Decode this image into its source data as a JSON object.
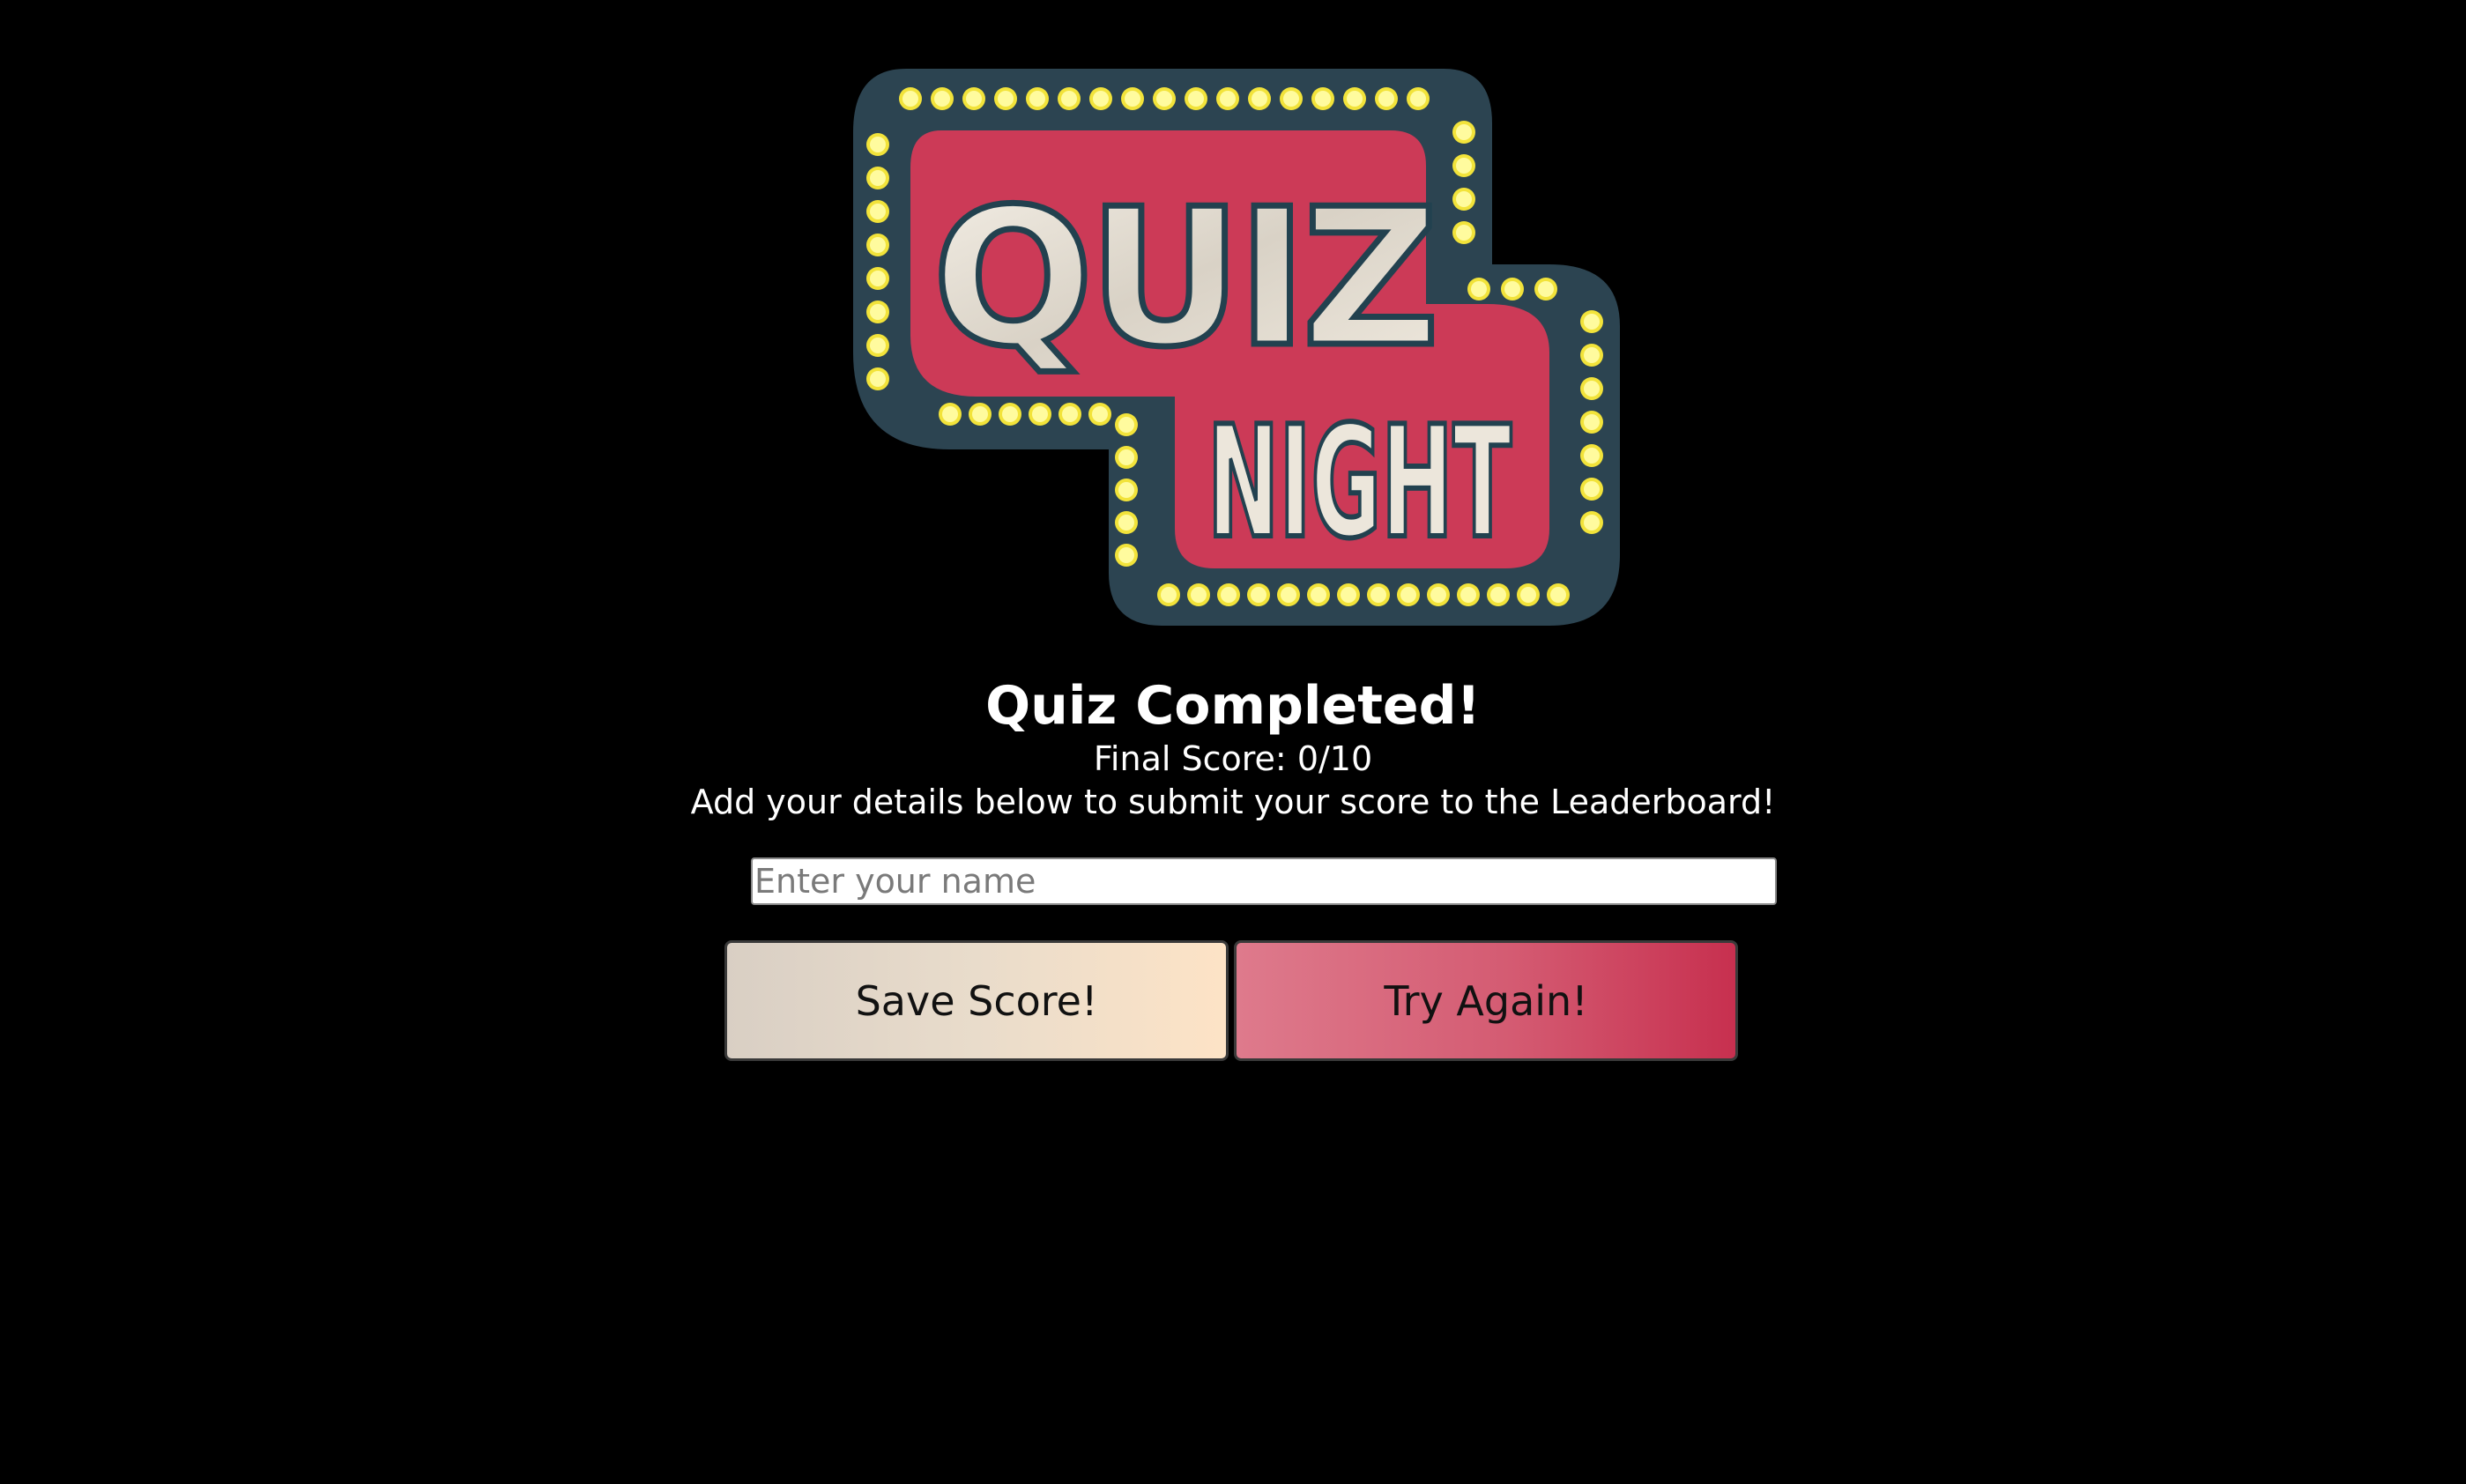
{
  "logo": {
    "line1": "QUIZ",
    "line2": "NIGHT",
    "colors": {
      "outer": "#2c4451",
      "inner": "#cc3a57",
      "bulb": "#fffb9e",
      "bulb_glow": "#f2e33a",
      "letter_fill": "#ece6db",
      "letter_stroke": "#22414f"
    }
  },
  "result": {
    "heading": "Quiz Completed!",
    "final_score": "Final Score: 0/10",
    "instructions": "Add your details below to submit your score to the Leaderboard!"
  },
  "form": {
    "name_placeholder": "Enter your name",
    "name_value": ""
  },
  "buttons": {
    "save_label": "Save Score!",
    "retry_label": "Try Again!"
  }
}
